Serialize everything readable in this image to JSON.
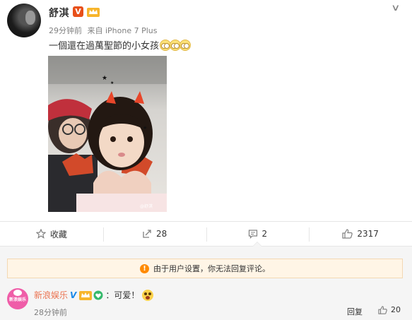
{
  "post": {
    "username": "舒淇",
    "verified_badge": "V",
    "time": "29分钟前",
    "source": "来自 iPhone 7 Plus",
    "text": "一個還在過萬聖節的小女孩",
    "emoji_count": 3,
    "image_watermark": "@舒淇",
    "icons": [
      "chevron-down-icon",
      "crown-badge-icon",
      "emoji-eyes-icon"
    ]
  },
  "actions": {
    "favorite_label": "收藏",
    "repost_count": "28",
    "comment_count": "2",
    "like_count": "2317"
  },
  "comments": {
    "notice": "由于用户设置，你无法回复评论。",
    "items": [
      {
        "author": "新浪娱乐",
        "verified": "V",
        "text": "：可爱！",
        "time": "28分钟前",
        "reply_label": "回复",
        "likes": "20",
        "avatar_text": "新浪娱乐"
      }
    ]
  },
  "colors": {
    "link_orange": "#eb7350",
    "verified_orange": "#e8501a",
    "verified_blue": "#1a88e8",
    "notice_bg": "#fff5e6",
    "comment_bg": "#f5f5f5"
  }
}
